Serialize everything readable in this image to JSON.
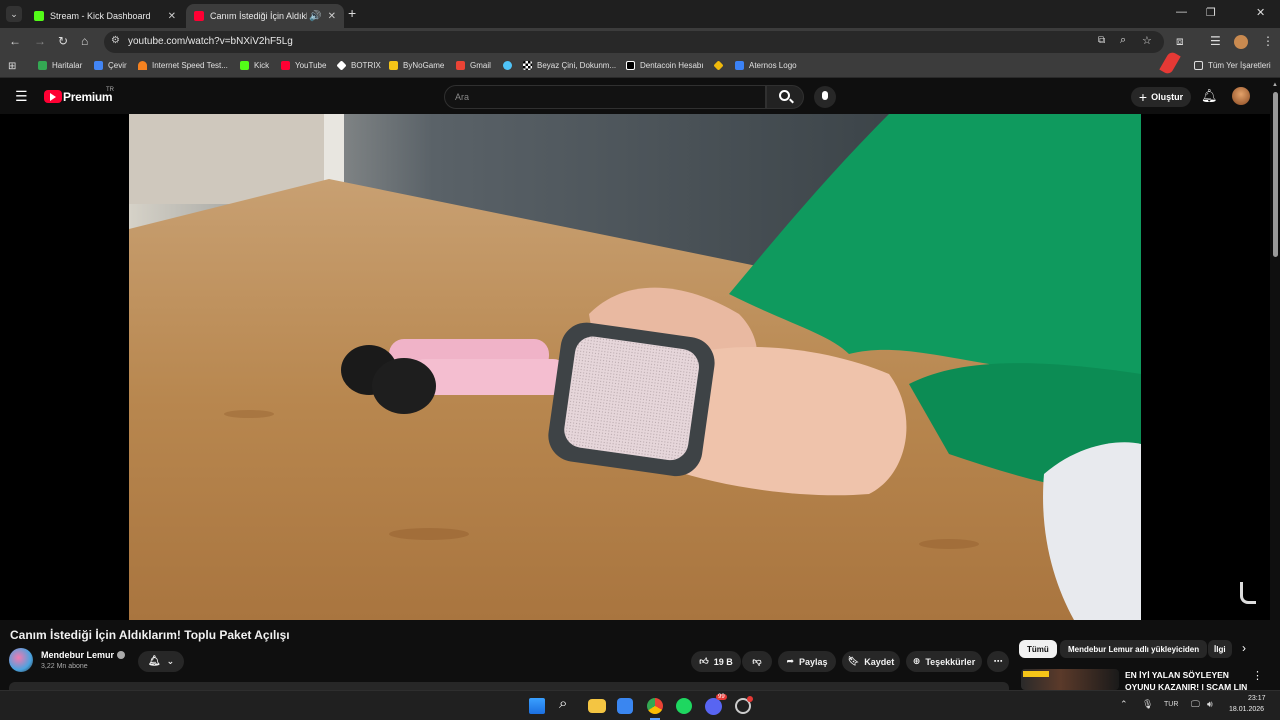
{
  "tabs": [
    {
      "label": "Stream - Kick Dashboard",
      "favicon_color": "#53fc18",
      "active": false
    },
    {
      "label": "Canım İstediği İçin Aldıklarım",
      "favicon_color": "#ff0033",
      "active": true
    }
  ],
  "toolbar": {
    "url": "youtube.com/watch?v=bNXiV2hF5Lg"
  },
  "bookmarks": [
    {
      "label": "Haritalar",
      "icon": "maps-icon",
      "color": "#34a853"
    },
    {
      "label": "Çevir",
      "icon": "translate-icon",
      "color": "#4285f4"
    },
    {
      "label": "Internet Speed Test...",
      "icon": "speedtest-icon",
      "color": "#f58220"
    },
    {
      "label": "Kick",
      "icon": "kick-icon",
      "color": "#53fc18"
    },
    {
      "label": "YouTube",
      "icon": "youtube-icon",
      "color": "#ff0033"
    },
    {
      "label": "BOTRIX",
      "icon": "botrix-icon",
      "color": "#ffffff"
    },
    {
      "label": "ByNoGame",
      "icon": "bynogame-icon",
      "color": "#f5c518"
    },
    {
      "label": "Gmail",
      "icon": "gmail-icon",
      "color": "#ea4335"
    },
    {
      "label": "",
      "icon": "globe-icon",
      "color": "#4fc3f7"
    },
    {
      "label": "Beyaz Çini, Dokunm...",
      "icon": "checker-icon",
      "color": "#ffffff"
    },
    {
      "label": "Dentacoin Hesabı",
      "icon": "dentacoin-icon",
      "color": "#ffffff"
    },
    {
      "label": "",
      "icon": "binance-icon",
      "color": "#f0b90b"
    },
    {
      "label": "Aternos Logo",
      "icon": "aternos-icon",
      "color": "#3b82f6"
    }
  ],
  "all_bookmarks": "Tüm Yer İşaretleri",
  "header": {
    "logo": "Premium",
    "logo_badge": "TR",
    "search_placeholder": "Ara",
    "create_label": "Oluştur"
  },
  "video": {
    "title": "Canım İstediği İçin Aldıklarım! Toplu Paket Açılışı",
    "channel": "Mendebur Lemur",
    "subscribers": "3,22 Mn abone",
    "likes": "19 B",
    "share": "Paylaş",
    "save": "Kaydet",
    "thanks": "Teşekkürler"
  },
  "chips": [
    "Tümü",
    "Mendebur Lemur adlı yükleyiciden",
    "İlgi"
  ],
  "recommended": {
    "title_line1": "EN İYİ YALAN SÖYLEYEN",
    "title_line2": "OYUNU KAZANIR! | SCAM LIN"
  },
  "taskbar": {
    "lang": "TUR",
    "time": "23:17",
    "date": "18.01.2026",
    "discord_badge": "99"
  }
}
